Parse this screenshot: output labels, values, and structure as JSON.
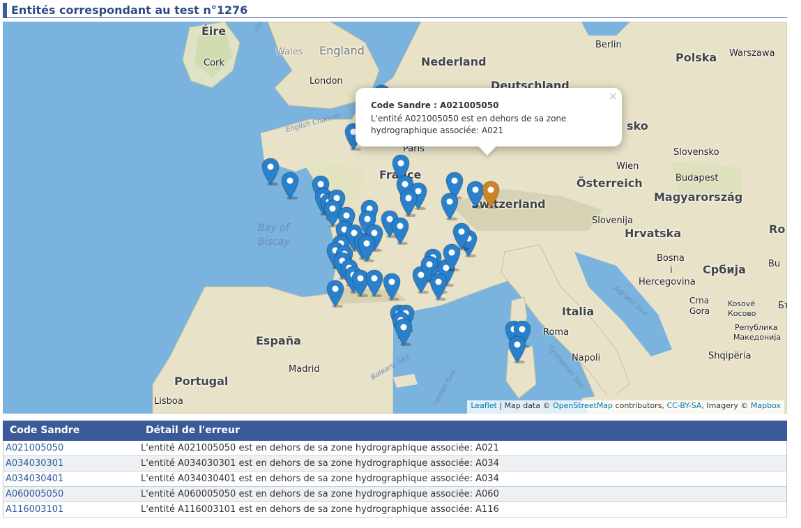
{
  "page_title": "Entités correspondant au test n°1276",
  "map": {
    "countries": {
      "ireland": "Éire",
      "england": "England",
      "nederland": "Nederland",
      "deutschland": "Deutschland",
      "polska": "Polska",
      "france": "France",
      "switzerland": "Switzerland",
      "osterreich": "Österreich",
      "slovensko": "Slovensko",
      "magyarorszag": "Magyarország",
      "slovenija": "Slovenija",
      "hrvatska": "Hrvatska",
      "espana": "España",
      "portugal": "Portugal",
      "italia": "Italia",
      "srbija": "Србија",
      "ro": "Ro",
      "bosna": "Bosna",
      "bosna_i": "i",
      "hercegovina": "Hercegovina",
      "crna": "Crna",
      "gora": "Gora",
      "kosovo": "Kosovë",
      "kosovo2": "Косово",
      "macedonia1": "Република",
      "macedonia2": "Македонија",
      "shqiperia": "Shqipëria",
      "bu": "Bu",
      "bulgaria_stub": "Бъ"
    },
    "cities": {
      "cork": "Cork",
      "london": "London",
      "berlin": "Berlin",
      "warszawa": "Warszawa",
      "paris": "Paris",
      "wien": "Wien",
      "budapest": "Budapest",
      "madrid": "Madrid",
      "lisboa": "Lisboa",
      "roma": "Roma",
      "napoli": "Napoli",
      "wales": "Wales",
      "sko": "sko"
    },
    "seas": {
      "bay_of_biscay_1": "Bay of",
      "bay_of_biscay_2": "Biscay",
      "english_channel": "English Channel",
      "irish_sea": "Irish",
      "adriatic_sea": "Adriatic Sea",
      "balearic_sea": "Balearic Sea",
      "tyrrhenian_sea": "Tyrrhenian Sea",
      "mediterranean": "ranean Sea"
    },
    "popup": {
      "title": "Code Sandre : A021005050",
      "body": "L'entité A021005050 est en dehors de sa zone hydrographique associée: A021",
      "close_glyph": "×"
    },
    "attribution": {
      "leaflet": "Leaflet",
      "sep1": " | Map data © ",
      "osm": "OpenStreetMap",
      "contrib": " contributors, ",
      "ccbysa": "CC-BY-SA",
      "imagery": ", Imagery © ",
      "mapbox": "Mapbox"
    },
    "colors": {
      "marker_blue": "#2a81cb",
      "marker_orange": "#cb8427",
      "sea": "#7ab3dd",
      "land": "#e8e2c8"
    }
  },
  "table": {
    "headers": {
      "code": "Code Sandre",
      "detail": "Détail de l'erreur"
    },
    "rows": [
      {
        "code": "A021005050",
        "detail": "L'entité A021005050 est en dehors de sa zone hydrographique associée: A021"
      },
      {
        "code": "A034030301",
        "detail": "L'entité A034030301 est en dehors de sa zone hydrographique associée: A034"
      },
      {
        "code": "A034030401",
        "detail": "L'entité A034030401 est en dehors de sa zone hydrographique associée: A034"
      },
      {
        "code": "A060005050",
        "detail": "L'entité A060005050 est en dehors de sa zone hydrographique associée: A060"
      },
      {
        "code": "A116003101",
        "detail": "L'entité A116003101 est en dehors de sa zone hydrographique associée: A116"
      }
    ]
  }
}
